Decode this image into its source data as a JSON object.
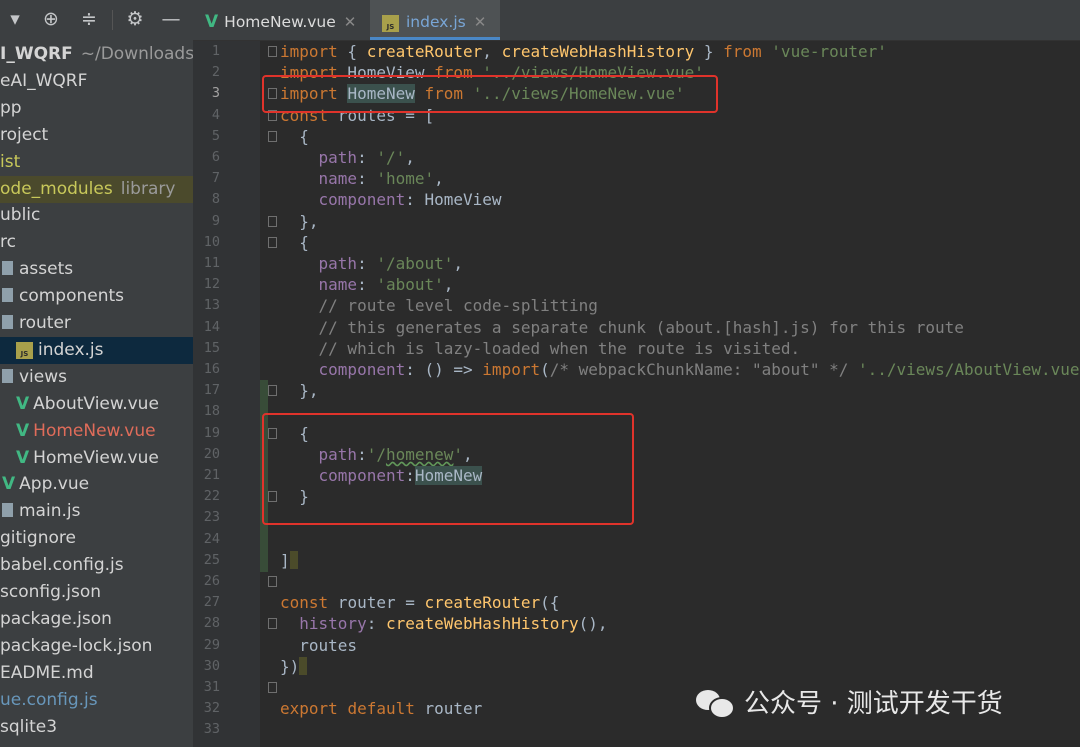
{
  "sidebar": {
    "items": [
      {
        "label": "I_WQRF",
        "extra": "~/Downloads",
        "kind": "text"
      },
      {
        "label": "eAI_WQRF",
        "kind": "text"
      },
      {
        "label": "pp",
        "kind": "text"
      },
      {
        "label": "roject",
        "kind": "text"
      },
      {
        "label": "ist",
        "kind": "text-yellow"
      },
      {
        "label": "ode_modules",
        "extra": "library",
        "kind": "modules"
      },
      {
        "label": "ublic",
        "kind": "text"
      },
      {
        "label": "rc",
        "kind": "text"
      },
      {
        "label": "assets",
        "kind": "folder"
      },
      {
        "label": "components",
        "kind": "folder"
      },
      {
        "label": "router",
        "kind": "folder"
      },
      {
        "label": "index.js",
        "kind": "js-selected"
      },
      {
        "label": "views",
        "kind": "folder"
      },
      {
        "label": "AboutView.vue",
        "kind": "vue"
      },
      {
        "label": "HomeNew.vue",
        "kind": "vue-red"
      },
      {
        "label": "HomeView.vue",
        "kind": "vue"
      },
      {
        "label": "App.vue",
        "kind": "vue"
      },
      {
        "label": "main.js",
        "kind": "folder"
      },
      {
        "label": "gitignore",
        "kind": "text"
      },
      {
        "label": "babel.config.js",
        "kind": "text"
      },
      {
        "label": "sconfig.json",
        "kind": "text"
      },
      {
        "label": "package.json",
        "kind": "text"
      },
      {
        "label": "package-lock.json",
        "kind": "text"
      },
      {
        "label": "EADME.md",
        "kind": "text"
      },
      {
        "label": "ue.config.js",
        "kind": "text-blue"
      },
      {
        "label": "sqlite3",
        "kind": "text"
      }
    ]
  },
  "tabs": [
    {
      "label": "HomeNew.vue",
      "icon": "vue-icon",
      "active": false
    },
    {
      "label": "index.js",
      "icon": "js-file-icon",
      "active": true
    }
  ],
  "editor": {
    "line_numbers": [
      "1",
      "2",
      "3",
      "4",
      "5",
      "6",
      "7",
      "8",
      "9",
      "10",
      "11",
      "12",
      "13",
      "14",
      "15",
      "16",
      "17",
      "18",
      "19",
      "20",
      "21",
      "22",
      "23",
      "24",
      "25",
      "26",
      "27",
      "28",
      "29",
      "30",
      "31",
      "32",
      "33"
    ],
    "current_line": "3",
    "lines": [
      "import { createRouter, createWebHashHistory } from 'vue-router'",
      "import HomeView from '../views/HomeView.vue'",
      "import HomeNew from '../views/HomeNew.vue'",
      "const routes = [",
      "  {",
      "    path: '/',",
      "    name: 'home',",
      "    component: HomeView",
      "  },",
      "  {",
      "    path: '/about',",
      "    name: 'about',",
      "    // route level code-splitting",
      "    // this generates a separate chunk (about.[hash].js) for this route",
      "    // which is lazy-loaded when the route is visited.",
      "    component: () => import(/* webpackChunkName: \"about\" */ '../views/AboutView.vue')",
      "  },",
      "",
      "  {",
      "    path:'/homenew',",
      "    component:HomeNew",
      "  }",
      "",
      "",
      "]",
      "",
      "const router = createRouter({",
      "  history: createWebHashHistory(),",
      "  routes",
      "})",
      "",
      "export default router"
    ]
  },
  "watermark": {
    "text": "公众号 · 测试开发干货",
    "icon": "wechat-icon"
  },
  "colors": {
    "keyword": "#cc7832",
    "string": "#6a8759",
    "property": "#9876aa",
    "function": "#ffc66d",
    "comment": "#808080",
    "highlight_box": "#e0332b"
  }
}
